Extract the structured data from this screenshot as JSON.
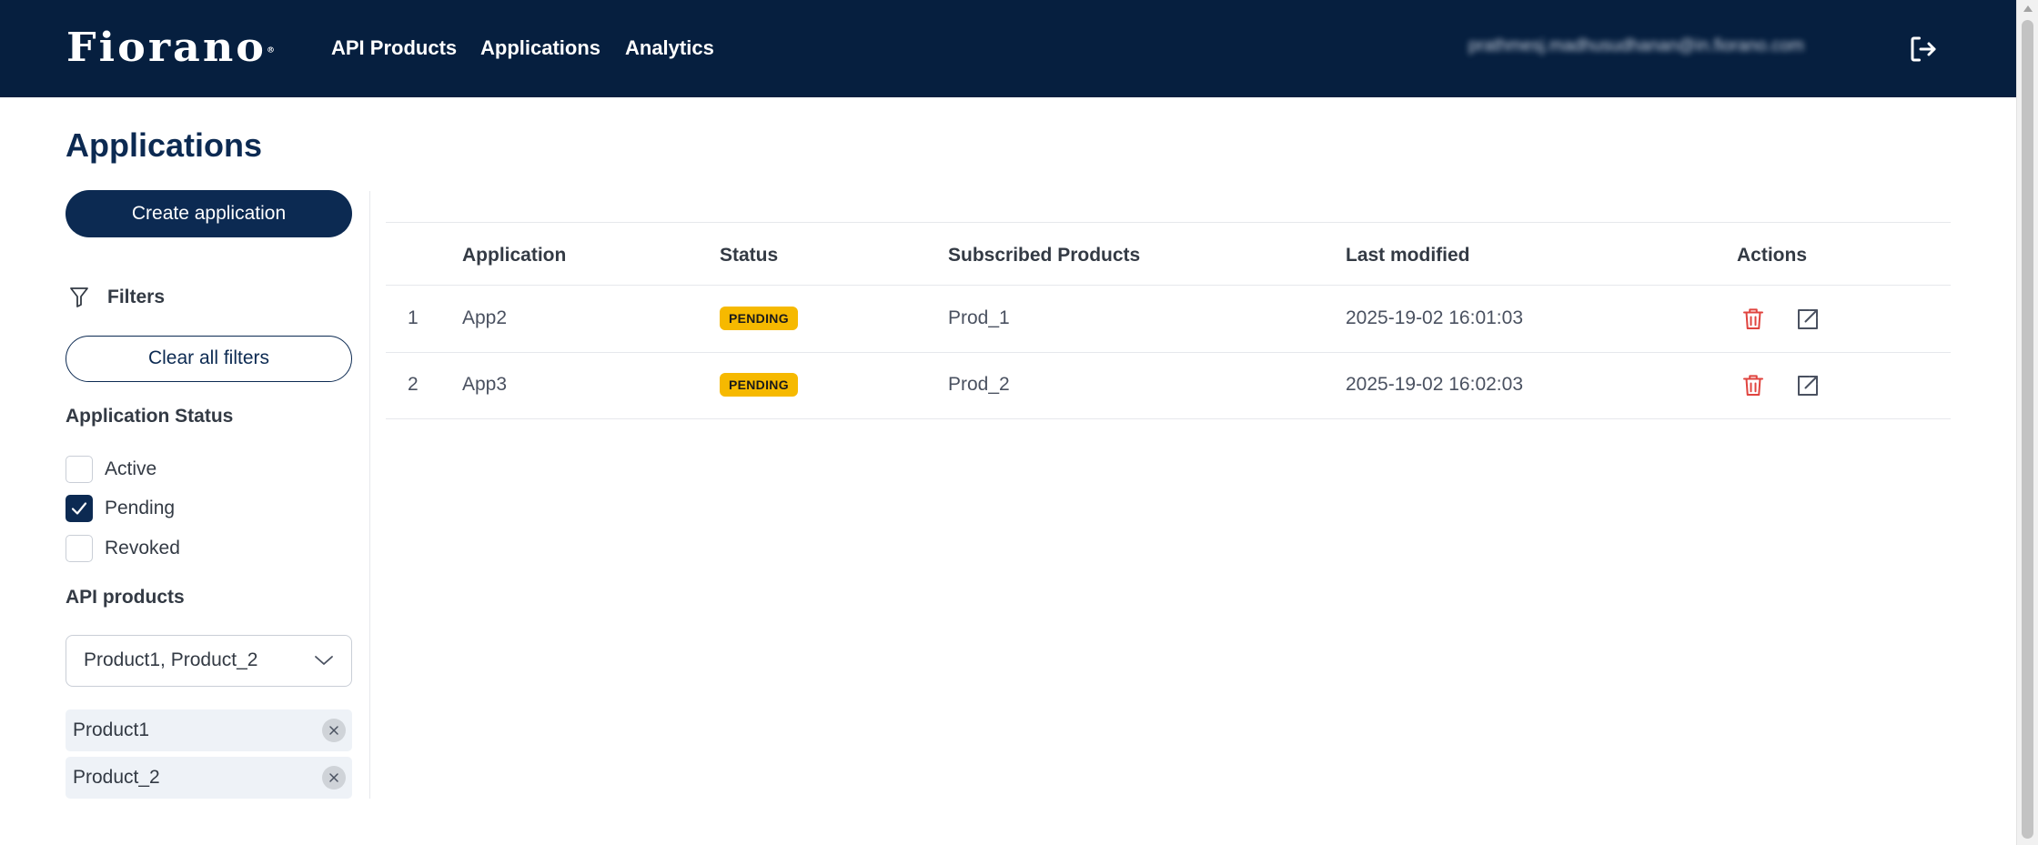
{
  "header": {
    "logo_text": "Fiorano",
    "logo_mark": "®",
    "nav": [
      "API Products",
      "Applications",
      "Analytics"
    ],
    "user_email": "prathmesj.madhusudhanan@in.fiorano.com",
    "logout_icon": "logout-icon",
    "background": "#061f3f"
  },
  "page": {
    "title": "Applications"
  },
  "sidebar": {
    "create_label": "Create application",
    "filters_label": "Filters",
    "clear_label": "Clear all filters",
    "status_title": "Application Status",
    "statuses": [
      {
        "label": "Active",
        "checked": false
      },
      {
        "label": "Pending",
        "checked": true
      },
      {
        "label": "Revoked",
        "checked": false
      }
    ],
    "products_title": "API products",
    "products_selected": "Product1, Product_2",
    "chips": [
      "Product1",
      "Product_2"
    ]
  },
  "table": {
    "columns": [
      "Application",
      "Status",
      "Subscribed Products",
      "Last modified",
      "Actions"
    ],
    "rows": [
      {
        "index": "1",
        "application": "App2",
        "status": "PENDING",
        "products": "Prod_1",
        "modified": "2025-19-02 16:01:03"
      },
      {
        "index": "2",
        "application": "App3",
        "status": "PENDING",
        "products": "Prod_2",
        "modified": "2025-19-02 16:02:03"
      }
    ]
  },
  "colors": {
    "brand": "#0c2a52",
    "badge_pending": "#f6b900",
    "delete_red": "#e0443f"
  }
}
